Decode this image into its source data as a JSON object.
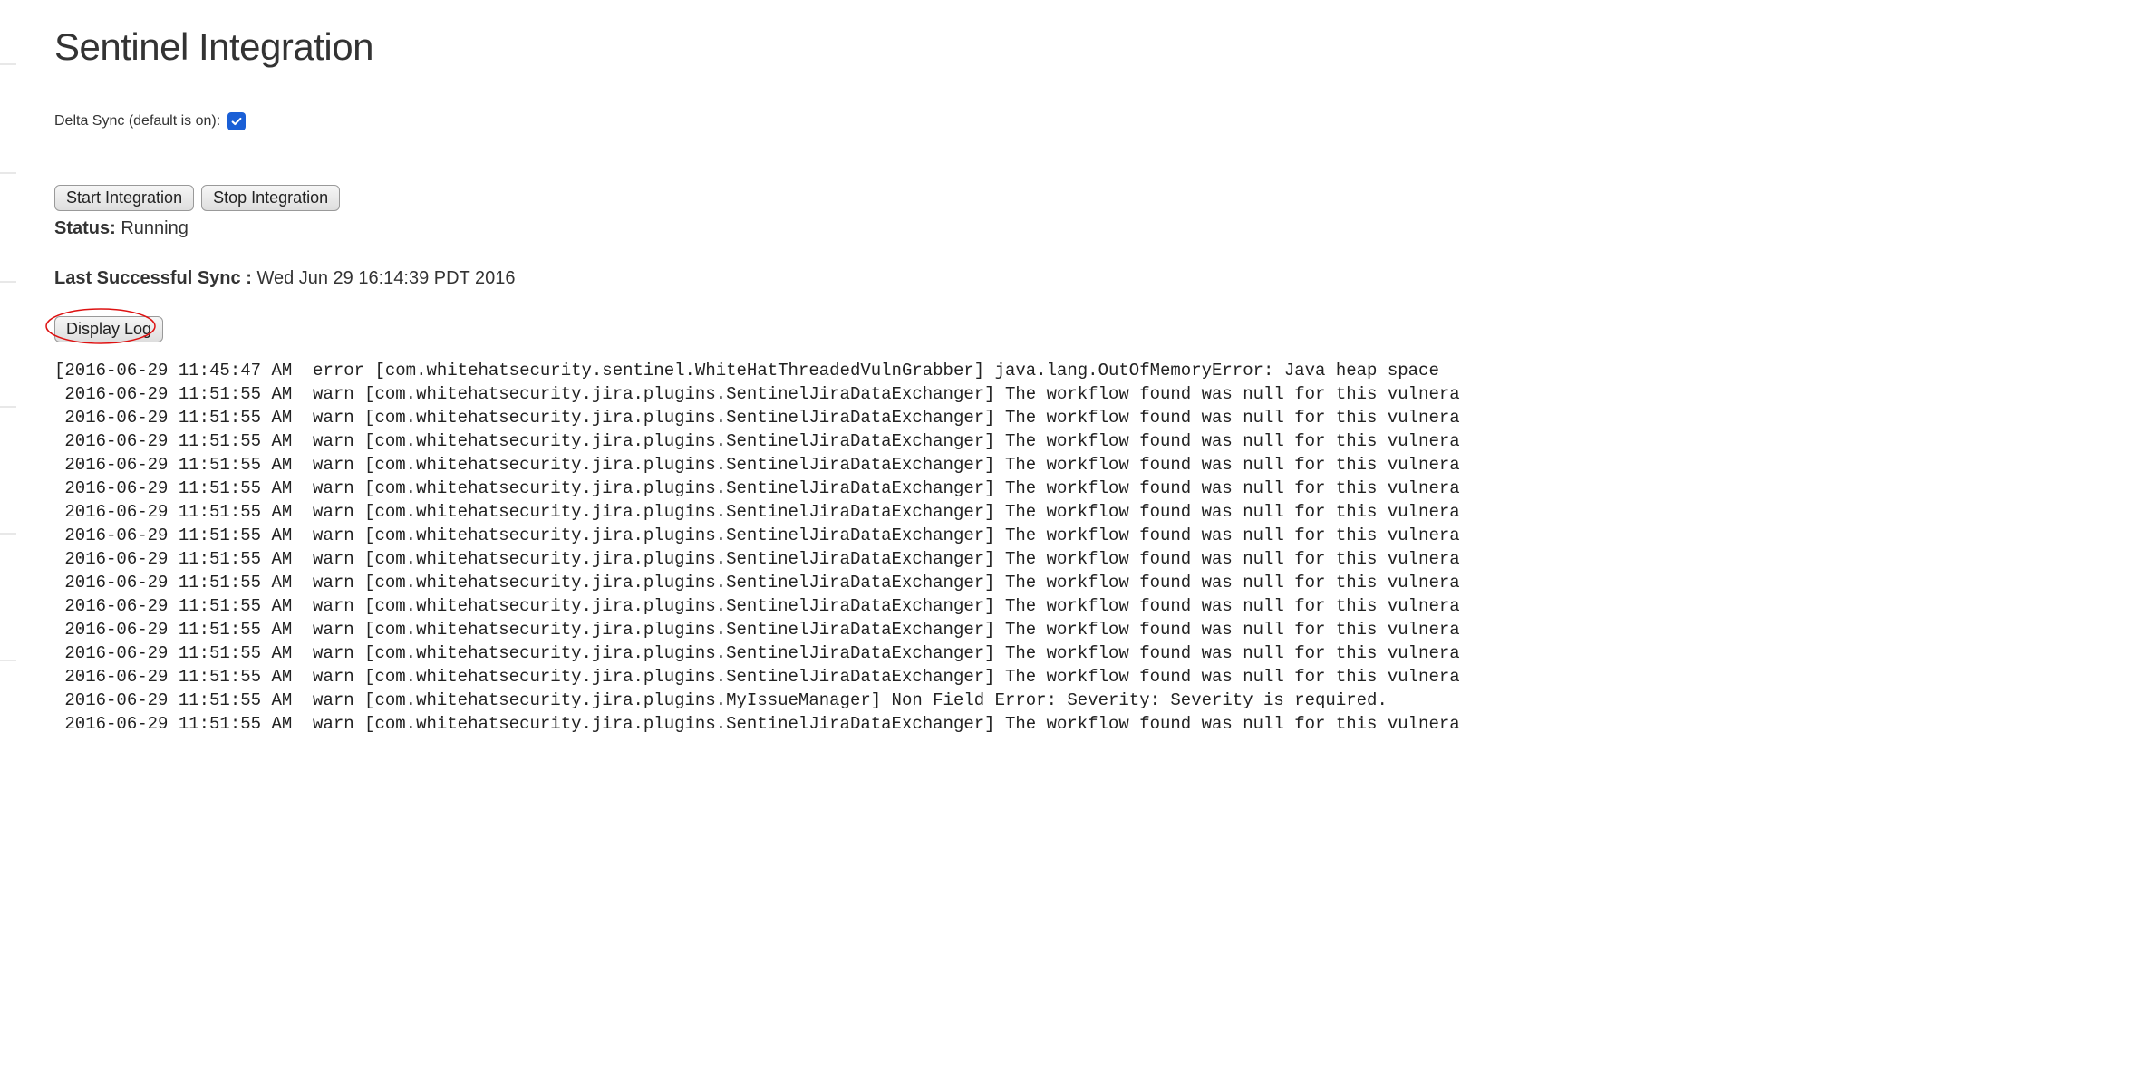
{
  "header": {
    "title": "Sentinel Integration"
  },
  "deltaSync": {
    "label": "Delta Sync (default is on):",
    "checked": true
  },
  "buttons": {
    "start": "Start Integration",
    "stop": "Stop Integration",
    "displayLog": "Display Log"
  },
  "status": {
    "label": "Status:",
    "value": "Running"
  },
  "lastSync": {
    "label": "Last Successful Sync :",
    "value": "Wed Jun 29 16:14:39 PDT 2016"
  },
  "log": {
    "lines": [
      "[2016-06-29 11:45:47 AM  error [com.whitehatsecurity.sentinel.WhiteHatThreadedVulnGrabber] java.lang.OutOfMemoryError: Java heap space",
      " 2016-06-29 11:51:55 AM  warn [com.whitehatsecurity.jira.plugins.SentinelJiraDataExchanger] The workflow found was null for this vulnera",
      " 2016-06-29 11:51:55 AM  warn [com.whitehatsecurity.jira.plugins.SentinelJiraDataExchanger] The workflow found was null for this vulnera",
      " 2016-06-29 11:51:55 AM  warn [com.whitehatsecurity.jira.plugins.SentinelJiraDataExchanger] The workflow found was null for this vulnera",
      " 2016-06-29 11:51:55 AM  warn [com.whitehatsecurity.jira.plugins.SentinelJiraDataExchanger] The workflow found was null for this vulnera",
      " 2016-06-29 11:51:55 AM  warn [com.whitehatsecurity.jira.plugins.SentinelJiraDataExchanger] The workflow found was null for this vulnera",
      " 2016-06-29 11:51:55 AM  warn [com.whitehatsecurity.jira.plugins.SentinelJiraDataExchanger] The workflow found was null for this vulnera",
      " 2016-06-29 11:51:55 AM  warn [com.whitehatsecurity.jira.plugins.SentinelJiraDataExchanger] The workflow found was null for this vulnera",
      " 2016-06-29 11:51:55 AM  warn [com.whitehatsecurity.jira.plugins.SentinelJiraDataExchanger] The workflow found was null for this vulnera",
      " 2016-06-29 11:51:55 AM  warn [com.whitehatsecurity.jira.plugins.SentinelJiraDataExchanger] The workflow found was null for this vulnera",
      " 2016-06-29 11:51:55 AM  warn [com.whitehatsecurity.jira.plugins.SentinelJiraDataExchanger] The workflow found was null for this vulnera",
      " 2016-06-29 11:51:55 AM  warn [com.whitehatsecurity.jira.plugins.SentinelJiraDataExchanger] The workflow found was null for this vulnera",
      " 2016-06-29 11:51:55 AM  warn [com.whitehatsecurity.jira.plugins.SentinelJiraDataExchanger] The workflow found was null for this vulnera",
      " 2016-06-29 11:51:55 AM  warn [com.whitehatsecurity.jira.plugins.SentinelJiraDataExchanger] The workflow found was null for this vulnera",
      " 2016-06-29 11:51:55 AM  warn [com.whitehatsecurity.jira.plugins.MyIssueManager] Non Field Error: Severity: Severity is required.",
      " 2016-06-29 11:51:55 AM  warn [com.whitehatsecurity.jira.plugins.SentinelJiraDataExchanger] The workflow found was null for this vulnera"
    ]
  }
}
